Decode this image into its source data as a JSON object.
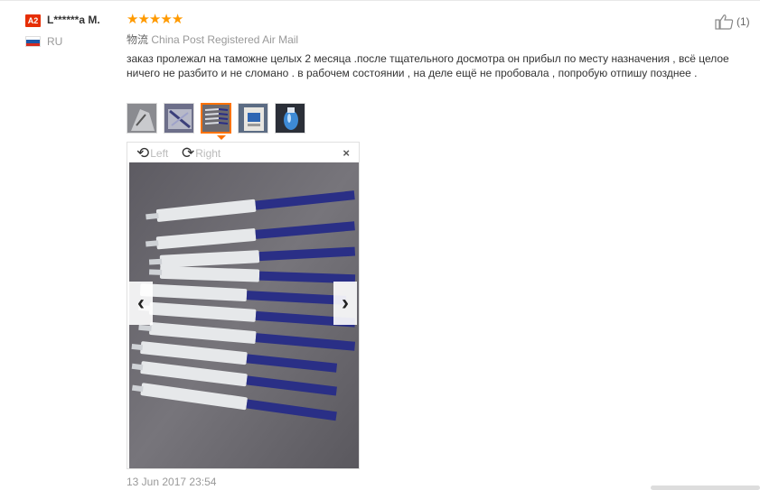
{
  "user": {
    "level_badge": "A2",
    "name": "L******a M.",
    "country_code": "RU"
  },
  "rating": {
    "stars": 5,
    "max": 5,
    "color": "#ff9a00"
  },
  "shipping": {
    "label": "物流",
    "method": "China Post Registered Air Mail"
  },
  "review_text": "заказ пролежал на таможне целых 2 месяца .после тщательного досмотра он прибыл по месту назначения , всё целое ничего не разбито и не сломано . в рабочем состоянии , на деле ещё не пробовала , попробую отпишу позднее .",
  "thumbnails": [
    {
      "icon": "photo-thumbnail",
      "active": false
    },
    {
      "icon": "photo-thumbnail",
      "active": false
    },
    {
      "icon": "photo-thumbnail",
      "active": true
    },
    {
      "icon": "photo-thumbnail",
      "active": false
    },
    {
      "icon": "photo-thumbnail",
      "active": false
    }
  ],
  "viewer": {
    "rotate_left_label": "Left",
    "rotate_right_label": "Right",
    "close_symbol": "×",
    "prev_symbol": "‹",
    "next_symbol": "›",
    "photo_subject": "syringes of whitening gel with blue plungers"
  },
  "date": "13 Jun 2017 23:54",
  "helpful": {
    "icon": "thumbs-up-icon",
    "count": "(1)"
  },
  "colors": {
    "badge": "#e62e04",
    "accent_orange": "#ff7300",
    "plunger_blue": "#2a2f86"
  }
}
